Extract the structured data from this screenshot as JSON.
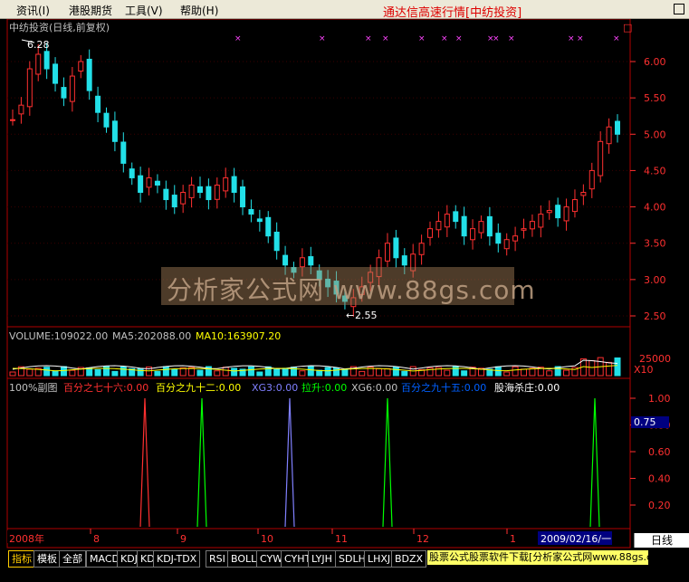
{
  "menu": {
    "items": [
      "资讯(I)",
      "港股期货",
      "工具(V)",
      "帮助(H)"
    ],
    "title": "通达信高速行情[中纺投资]"
  },
  "chart_header": {
    "stock": "中纺投资(日线,前复权)",
    "hi_label": "6.28",
    "lo_label": "2.55"
  },
  "price_axis": [
    "6.00",
    "5.50",
    "5.00",
    "4.50",
    "4.00",
    "3.50",
    "3.00",
    "2.50"
  ],
  "volume_header": {
    "volume": "VOLUME:109022.00",
    "ma5": "MA5:202088.00",
    "ma10": "MA10:163907.20"
  },
  "volume_axis": {
    "value": "25000",
    "unit": "X10"
  },
  "indicator_header": {
    "name": "100%副图",
    "f1": "百分之七十六:0.00",
    "f2": "百分之九十二:0.00",
    "f3": "XG3:0.00",
    "f4": "拉升:0.00",
    "f5": "XG6:0.00",
    "f6": "百分之九十五:0.00",
    "f7": "股海杀庄:0.00"
  },
  "indicator_axis": [
    "1.00",
    "0.80",
    "0.60",
    "0.40",
    "0.20"
  ],
  "indicator_marker": "0.75",
  "time_axis": [
    "2008年",
    "8",
    "9",
    "10",
    "11",
    "12",
    "1"
  ],
  "date_label": "2009/02/16/一",
  "day_button": "日线",
  "watermark": "分析家公式网 www.88gs.com",
  "tabs": [
    "指标",
    "模板",
    "全部",
    "MACD",
    "KDJ",
    "KD",
    "KDJ-TDX",
    "RSI",
    "BOLL",
    "CYW",
    "CYHT",
    "LYJH",
    "SDLH",
    "LHXJ",
    "BDZX"
  ],
  "ad_text": "股票公式股票软件下载[分析家公式网www.88gs.com]",
  "colors": {
    "up": "#ff3030",
    "down": "#22e0e8",
    "grid": "#8b0000",
    "axis": "#b00000"
  },
  "chart_data": {
    "type": "line",
    "price_close": [
      5.2,
      5.4,
      5.9,
      6.1,
      5.9,
      5.7,
      5.5,
      5.8,
      6.0,
      5.6,
      5.3,
      5.1,
      4.9,
      4.6,
      4.4,
      4.2,
      4.4,
      4.3,
      4.1,
      4.0,
      4.2,
      4.3,
      4.2,
      4.1,
      4.3,
      4.4,
      4.2,
      4.0,
      3.9,
      3.8,
      3.6,
      3.4,
      3.2,
      3.1,
      3.3,
      3.2,
      3.0,
      2.9,
      2.8,
      2.7,
      2.75,
      2.9,
      3.1,
      3.3,
      3.5,
      3.3,
      3.2,
      3.35,
      3.5,
      3.7,
      3.8,
      3.9,
      3.8,
      3.6,
      3.7,
      3.8,
      3.6,
      3.5,
      3.55,
      3.6,
      3.7,
      3.8,
      3.9,
      3.95,
      3.85,
      4.0,
      4.1,
      4.2,
      4.5,
      4.9,
      5.1,
      5.0
    ],
    "volume_ma10_label": "MA10:163907.20",
    "signal_positions_pct": [
      0.19,
      0.27,
      0.4,
      0.55,
      0.79
    ]
  }
}
